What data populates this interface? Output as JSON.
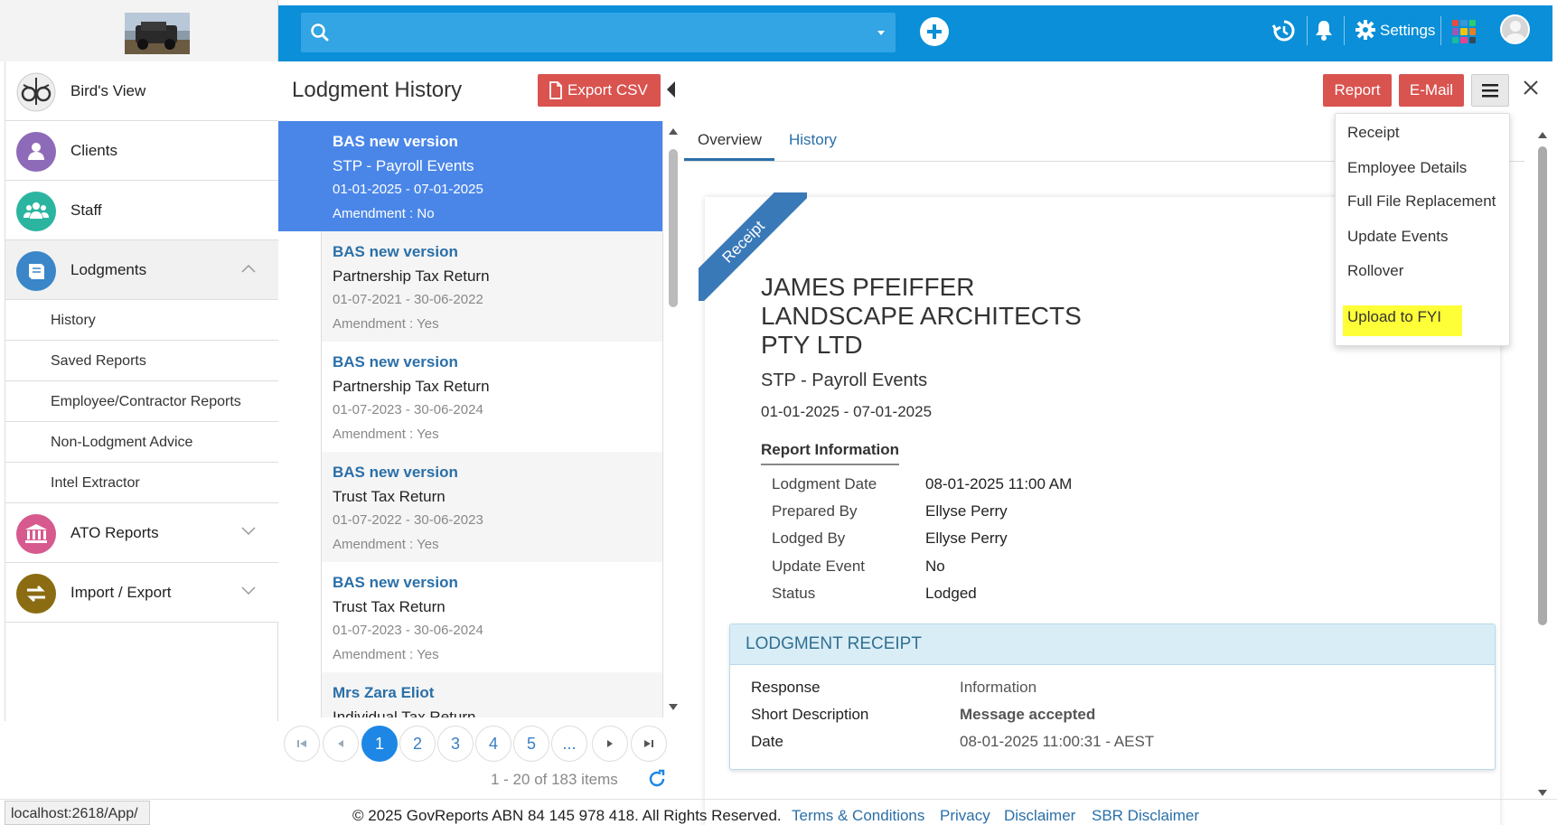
{
  "topbar": {
    "search_placeholder": "",
    "settings_label": "Settings"
  },
  "sidebar": {
    "items": [
      {
        "label": "Bird's View"
      },
      {
        "label": "Clients"
      },
      {
        "label": "Staff"
      },
      {
        "label": "Lodgments"
      },
      {
        "label": "ATO Reports"
      },
      {
        "label": "Import / Export"
      }
    ],
    "sub_items": [
      {
        "label": "History"
      },
      {
        "label": "Saved Reports"
      },
      {
        "label": "Employee/Contractor Reports"
      },
      {
        "label": "Non-Lodgment Advice"
      },
      {
        "label": "Intel Extractor"
      }
    ]
  },
  "list": {
    "title": "Lodgment History",
    "export_label": "Export CSV",
    "items": [
      {
        "title": "BAS new version",
        "type": "STP - Payroll Events",
        "period": "01-01-2025 - 07-01-2025",
        "amendment": "Amendment : No"
      },
      {
        "title": "BAS new version",
        "type": "Partnership Tax Return",
        "period": "01-07-2021 - 30-06-2022",
        "amendment": "Amendment : Yes"
      },
      {
        "title": "BAS new version",
        "type": "Partnership Tax Return",
        "period": "01-07-2023 - 30-06-2024",
        "amendment": "Amendment : Yes"
      },
      {
        "title": "BAS new version",
        "type": "Trust Tax Return",
        "period": "01-07-2022 - 30-06-2023",
        "amendment": "Amendment : Yes"
      },
      {
        "title": "BAS new version",
        "type": "Trust Tax Return",
        "period": "01-07-2023 - 30-06-2024",
        "amendment": "Amendment : Yes"
      },
      {
        "title": "Mrs Zara Eliot",
        "type": "Individual Tax Return",
        "period": "",
        "amendment": ""
      }
    ],
    "pages": [
      "1",
      "2",
      "3",
      "4",
      "5",
      "..."
    ],
    "current_page": "1",
    "pager_info": "1 - 20 of 183 items"
  },
  "details": {
    "report_label": "Report",
    "email_label": "E-Mail",
    "tabs": [
      {
        "label": "Overview"
      },
      {
        "label": "History"
      }
    ],
    "ribbon": "Receipt",
    "company_lines": [
      "JAMES PFEIFFER",
      "LANDSCAPE ARCHITECTS",
      "PTY LTD"
    ],
    "report_type": "STP - Payroll Events",
    "period": "01-01-2025 - 07-01-2025",
    "report_info_title": "Report Information",
    "report_info": [
      {
        "label": "Lodgment Date",
        "value": "08-01-2025 11:00 AM"
      },
      {
        "label": "Prepared By",
        "value": "Ellyse Perry"
      },
      {
        "label": "Lodged By",
        "value": "Ellyse Perry"
      },
      {
        "label": "Update Event",
        "value": "No"
      },
      {
        "label": "Status",
        "value": "Lodged"
      }
    ],
    "receipt": {
      "title": "LODGMENT RECEIPT",
      "rows": [
        {
          "label": "Response",
          "value": "Information"
        },
        {
          "label": "Short Description",
          "value": "Message accepted"
        },
        {
          "label": "Date",
          "value": "08-01-2025 11:00:31 - AEST"
        }
      ]
    }
  },
  "menu": {
    "items": [
      {
        "label": "Receipt"
      },
      {
        "label": "Employee Details"
      },
      {
        "label": "Full File Replacement"
      },
      {
        "label": "Update Events"
      },
      {
        "label": "Rollover"
      },
      {
        "label": "Upload to FYI"
      }
    ],
    "highlight_color": "#ffff38"
  },
  "footer": {
    "status_url": "localhost:2618/App/",
    "copyright": "© 2025 GovReports ABN 84 145 978 418. All Rights Reserved.",
    "links": [
      "Terms & Conditions",
      "Privacy",
      "Disclaimer",
      "SBR Disclaimer"
    ]
  },
  "colors": {
    "topbar": "#0a8fd8",
    "selected_item": "#4a86e8",
    "danger_button": "#d9534f",
    "link": "#2a6fa8",
    "receipt_header": "#d9edf7"
  },
  "icons": [
    "search-icon",
    "plus-icon",
    "history-icon",
    "bell-icon",
    "gear-icon",
    "apps-grid-icon",
    "user-avatar-icon",
    "owl-icon",
    "user-icon",
    "people-icon",
    "book-icon",
    "bank-icon",
    "swap-arrows-icon",
    "file-icon",
    "hamburger-icon",
    "close-icon",
    "refresh-icon"
  ]
}
